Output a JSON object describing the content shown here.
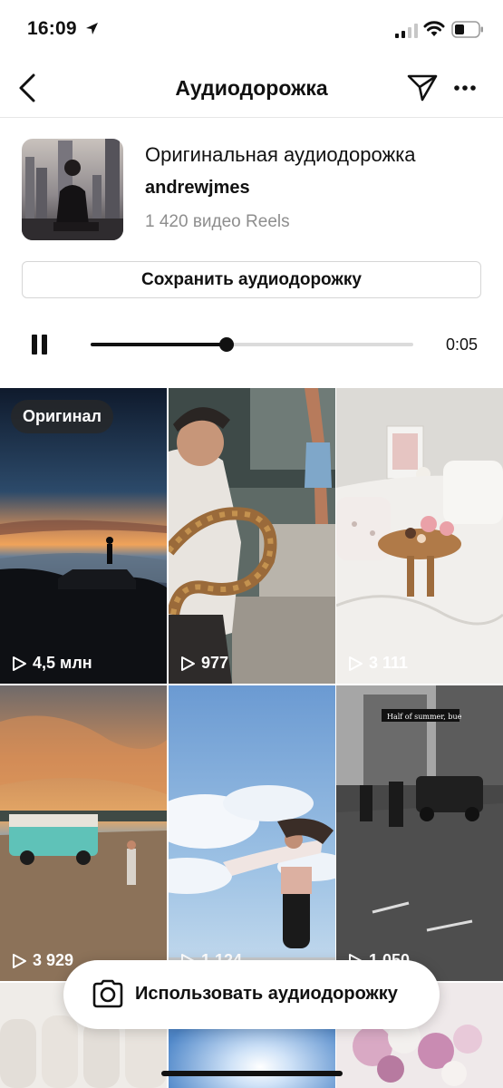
{
  "status_bar": {
    "time": "16:09",
    "icons": [
      "location-arrow-icon",
      "cellular-signal-icon",
      "wifi-icon",
      "battery-icon"
    ]
  },
  "nav": {
    "title": "Аудиодорожка",
    "back_icon": "chevron-left-icon",
    "send_icon": "paper-plane-icon",
    "more_icon": "ellipsis-icon"
  },
  "audio": {
    "title": "Оригинальная аудиодорожка",
    "author": "andrewjmes",
    "reels_count": "1 420 видео Reels"
  },
  "save_button": {
    "label": "Сохранить аудиодорожку"
  },
  "player": {
    "state": "playing",
    "progress": 0.42,
    "elapsed": "0:05"
  },
  "grid": {
    "original_badge": "Оригинал",
    "tiles": [
      {
        "views": "4,5 млн",
        "scene": "sunset over clouds"
      },
      {
        "views": "977",
        "scene": "girl with snake"
      },
      {
        "views": "3 111",
        "scene": "breakfast in bed"
      },
      {
        "views": "3 929",
        "scene": "camper van at sunset"
      },
      {
        "views": "1 124",
        "scene": "girl on beach sky"
      },
      {
        "views": "1 050",
        "scene": "motorcycles on street",
        "caption": "Half of summer, bue"
      },
      {
        "views": "",
        "scene": "white sofa"
      },
      {
        "views": "",
        "scene": "sun sky"
      },
      {
        "views": "",
        "scene": "flowers"
      }
    ]
  },
  "use_audio_button": {
    "label": "Использовать аудиодорожку",
    "icon": "camera-icon"
  },
  "colors": {
    "text": "#111111",
    "secondary": "#8e8e8e",
    "border": "#dbdbdb"
  }
}
